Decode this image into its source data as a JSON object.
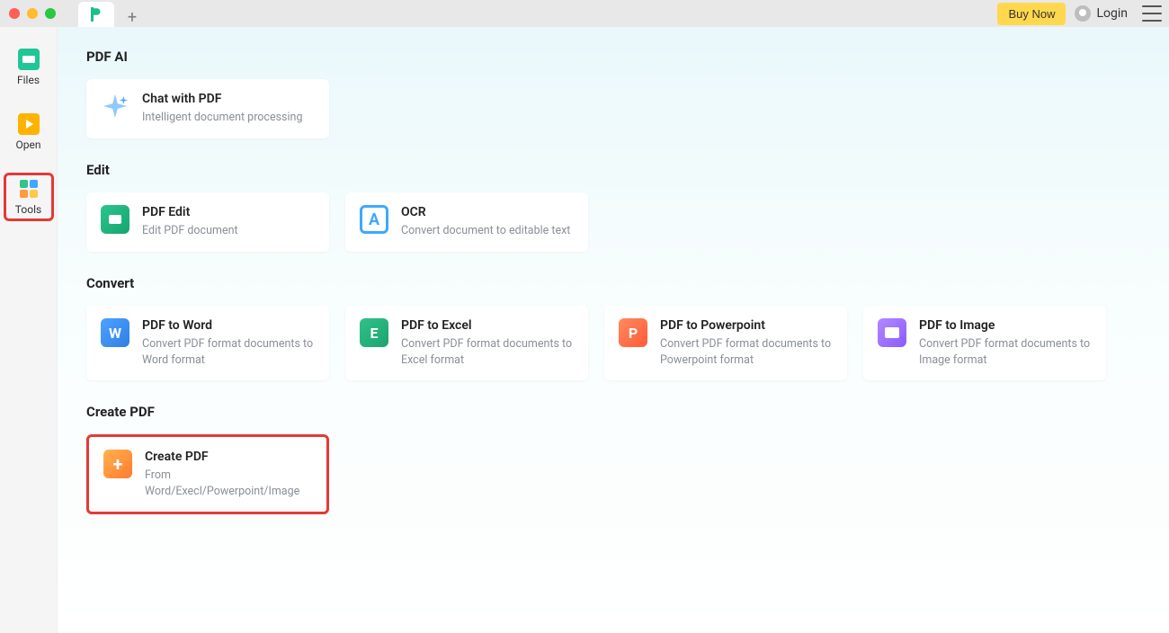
{
  "titlebar": {
    "buy_now": "Buy Now",
    "login": "Login"
  },
  "sidebar": {
    "items": [
      {
        "label": "Files"
      },
      {
        "label": "Open"
      },
      {
        "label": "Tools"
      }
    ]
  },
  "sections": {
    "pdf_ai": {
      "heading": "PDF AI",
      "cards": [
        {
          "title": "Chat with PDF",
          "sub": "Intelligent document processing"
        }
      ]
    },
    "edit": {
      "heading": "Edit",
      "cards": [
        {
          "title": "PDF Edit",
          "sub": "Edit PDF document"
        },
        {
          "title": "OCR",
          "sub": "Convert document to editable text"
        }
      ]
    },
    "convert": {
      "heading": "Convert",
      "cards": [
        {
          "title": "PDF to Word",
          "sub": "Convert PDF format documents to Word format"
        },
        {
          "title": "PDF to Excel",
          "sub": "Convert PDF format documents to Excel format"
        },
        {
          "title": "PDF to Powerpoint",
          "sub": "Convert PDF format documents to Powerpoint format"
        },
        {
          "title": "PDF to Image",
          "sub": "Convert PDF format documents to Image format"
        }
      ]
    },
    "create": {
      "heading": "Create PDF",
      "cards": [
        {
          "title": "Create PDF",
          "sub": "From Word/Execl/Powerpoint/Image"
        }
      ]
    }
  }
}
